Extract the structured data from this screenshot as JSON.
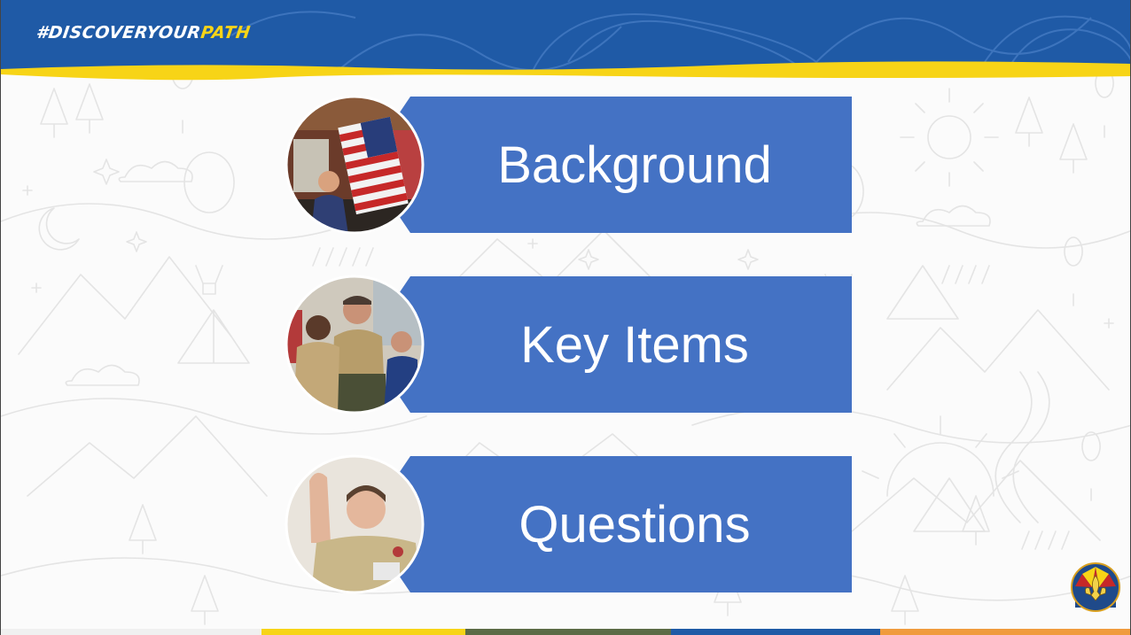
{
  "slide": {
    "hashtag_prefix": "#DISCOVERYOUR",
    "hashtag_accent": "PATH",
    "colors": {
      "header_blue": "#1f5aa6",
      "accent_yellow": "#f7d417",
      "banner_blue": "#4472c4",
      "footer": [
        "#f0f0f0",
        "#f7d417",
        "#5c6b46",
        "#1f5aa6",
        "#f09b3e"
      ]
    }
  },
  "agenda": {
    "items": [
      {
        "label": "Background",
        "photo": "flag-ceremony-photo"
      },
      {
        "label": "Key Items",
        "photo": "scout-leaders-photo"
      },
      {
        "label": "Questions",
        "photo": "scout-raising-hand-photo"
      }
    ]
  },
  "logo": {
    "icon": "council-fleur-de-lis-logo"
  }
}
